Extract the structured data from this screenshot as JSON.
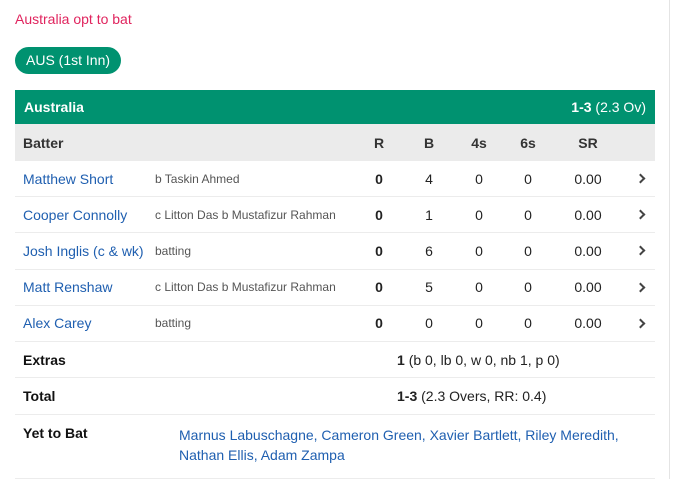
{
  "status": "Australia opt to bat",
  "innings_tab": "AUS (1st Inn)",
  "team": {
    "name": "Australia",
    "score": "1-3",
    "overs": "(2.3 Ov)"
  },
  "headers": {
    "batter": "Batter",
    "r": "R",
    "b": "B",
    "fours": "4s",
    "sixes": "6s",
    "sr": "SR"
  },
  "batters": [
    {
      "name": "Matthew Short",
      "dismissal": "b Taskin Ahmed",
      "r": "0",
      "b": "4",
      "fours": "0",
      "sixes": "0",
      "sr": "0.00"
    },
    {
      "name": "Cooper Connolly",
      "dismissal": "c Litton Das b Mustafizur Rahman",
      "r": "0",
      "b": "1",
      "fours": "0",
      "sixes": "0",
      "sr": "0.00"
    },
    {
      "name": "Josh Inglis (c & wk)",
      "dismissal": "batting",
      "r": "0",
      "b": "6",
      "fours": "0",
      "sixes": "0",
      "sr": "0.00"
    },
    {
      "name": "Matt Renshaw",
      "dismissal": "c Litton Das b Mustafizur Rahman",
      "r": "0",
      "b": "5",
      "fours": "0",
      "sixes": "0",
      "sr": "0.00"
    },
    {
      "name": "Alex Carey",
      "dismissal": "batting",
      "r": "0",
      "b": "0",
      "fours": "0",
      "sixes": "0",
      "sr": "0.00"
    }
  ],
  "extras": {
    "label": "Extras",
    "total": "1",
    "breakdown": "(b 0, lb 0, w 0, nb 1, p 0)"
  },
  "total": {
    "label": "Total",
    "score": "1-3",
    "detail": "(2.3 Overs, RR: 0.4)"
  },
  "yet_to_bat": {
    "label": "Yet to Bat",
    "players": "Marnus Labuschagne, Cameron Green, Xavier Bartlett, Riley Meredith, Nathan Ellis, Adam Zampa"
  },
  "colors": {
    "accent": "#009270",
    "status": "#e0245e",
    "link": "#1f5fb0",
    "header_bg": "#ebebeb"
  }
}
